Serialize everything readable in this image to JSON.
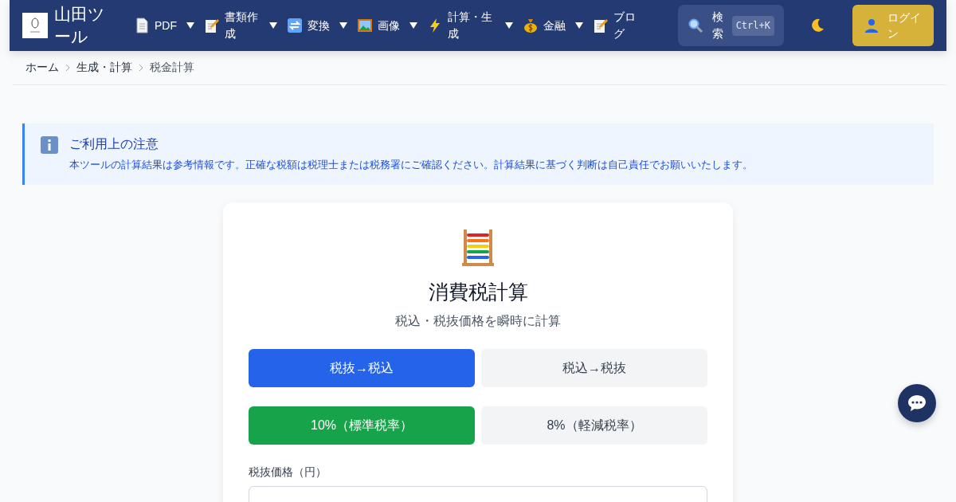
{
  "header": {
    "site_title": "山田ツール",
    "nav": [
      {
        "label": "PDF",
        "dropdown": true
      },
      {
        "label": "書類作成",
        "dropdown": true
      },
      {
        "label": "変換",
        "dropdown": true
      },
      {
        "label": "画像",
        "dropdown": true
      },
      {
        "label": "計算・生成",
        "dropdown": true
      },
      {
        "label": "金融",
        "dropdown": true
      },
      {
        "label": "ブログ",
        "dropdown": false
      }
    ],
    "search": {
      "label": "検索",
      "shortcut": "Ctrl+K"
    },
    "login": "ログイン"
  },
  "breadcrumb": [
    "ホーム",
    "生成・計算",
    "税金計算"
  ],
  "notice": {
    "title": "ご利用上の注意",
    "text": "本ツールの計算結果は参考情報です。正確な税額は税理士または税務署にご確認ください。計算結果に基づく判断は自己責任でお願いいたします。"
  },
  "calculator": {
    "title": "消費税計算",
    "subtitle": "税込・税抜価格を瞬時に計算",
    "mode_buttons": [
      {
        "label": "税抜→税込",
        "selected": true
      },
      {
        "label": "税込→税抜",
        "selected": false
      }
    ],
    "rate_buttons": [
      {
        "label": "10%（標準税率）",
        "selected": true
      },
      {
        "label": "8%（軽減税率）",
        "selected": false
      }
    ],
    "input_label": "税抜価格（円）"
  }
}
